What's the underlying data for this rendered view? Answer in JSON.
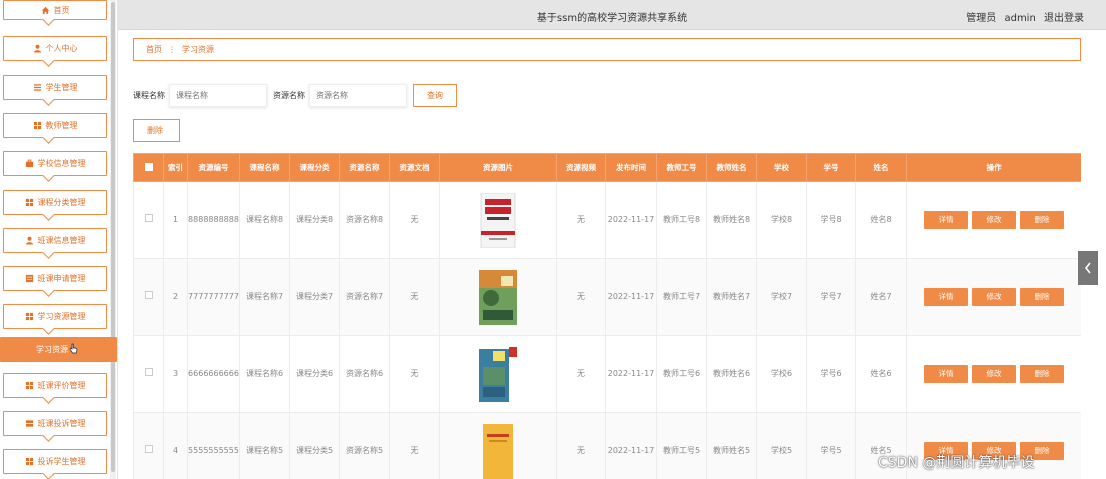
{
  "app": {
    "title": "基于ssm的高校学习资源共享系统",
    "role": "管理员",
    "username": "admin",
    "logout_label": "退出登录"
  },
  "sidebar": {
    "items": [
      {
        "label": "首页",
        "icon": "home-icon"
      },
      {
        "label": "个人中心",
        "icon": "user-icon"
      },
      {
        "label": "学生管理",
        "icon": "list-icon"
      },
      {
        "label": "教师管理",
        "icon": "grid-icon"
      },
      {
        "label": "学校信息管理",
        "icon": "briefcase-icon"
      },
      {
        "label": "课程分类管理",
        "icon": "grid-icon"
      },
      {
        "label": "班课信息管理",
        "icon": "user-icon"
      },
      {
        "label": "班课申请管理",
        "icon": "table-icon"
      },
      {
        "label": "学习资源管理",
        "icon": "grid-icon"
      },
      {
        "label": "学习资源",
        "icon": ""
      },
      {
        "label": "班课评价管理",
        "icon": "grid-icon"
      },
      {
        "label": "班课投诉管理",
        "icon": "stack-icon"
      },
      {
        "label": "投诉学生管理",
        "icon": "grid-icon"
      }
    ],
    "active_index": 9
  },
  "breadcrumb": {
    "home": "首页",
    "separator": "⋮",
    "current": "学习资源"
  },
  "search": {
    "course_label": "课程名称",
    "course_placeholder": "课程名称",
    "resource_label": "资源名称",
    "resource_placeholder": "资源名称",
    "query_button": "查询"
  },
  "toolbar": {
    "delete_label": "删除"
  },
  "table": {
    "headers": [
      "索引",
      "资源编号",
      "课程名称",
      "课程分类",
      "资源名称",
      "资源文档",
      "资源图片",
      "资源视频",
      "发布时间",
      "教师工号",
      "教师姓名",
      "学校",
      "学号",
      "姓名",
      "操作"
    ],
    "rows": [
      {
        "index": "1",
        "code": "8888888888",
        "course": "课程名称8",
        "category": "课程分类8",
        "resource": "资源名称8",
        "doc": "无",
        "video": "无",
        "time": "2022-11-17",
        "teacher_no": "教师工号8",
        "teacher": "教师姓名8",
        "school": "学校8",
        "student_no": "学号8",
        "name": "姓名8",
        "cover": "cover-red"
      },
      {
        "index": "2",
        "code": "7777777777",
        "course": "课程名称7",
        "category": "课程分类7",
        "resource": "资源名称7",
        "doc": "无",
        "video": "无",
        "time": "2022-11-17",
        "teacher_no": "教师工号7",
        "teacher": "教师姓名7",
        "school": "学校7",
        "student_no": "学号7",
        "name": "姓名7",
        "cover": "cover-green"
      },
      {
        "index": "3",
        "code": "6666666666",
        "course": "课程名称6",
        "category": "课程分类6",
        "resource": "资源名称6",
        "doc": "无",
        "video": "无",
        "time": "2022-11-17",
        "teacher_no": "教师工号6",
        "teacher": "教师姓名6",
        "school": "学校6",
        "student_no": "学号6",
        "name": "姓名6",
        "cover": "cover-blue"
      },
      {
        "index": "4",
        "code": "5555555555",
        "course": "课程名称5",
        "category": "课程分类5",
        "resource": "资源名称5",
        "doc": "无",
        "video": "无",
        "time": "2022-11-17",
        "teacher_no": "教师工号5",
        "teacher": "教师姓名5",
        "school": "学校5",
        "student_no": "学号5",
        "name": "姓名5",
        "cover": "cover-yellow"
      }
    ],
    "actions": {
      "detail": "详情",
      "edit": "修改",
      "delete": "删除"
    }
  },
  "watermark": "CSDN @荆圆计算机毕设",
  "colors": {
    "accent": "#f08a47",
    "accent_text": "#e3712a",
    "topbar": "#e5e5e5"
  }
}
